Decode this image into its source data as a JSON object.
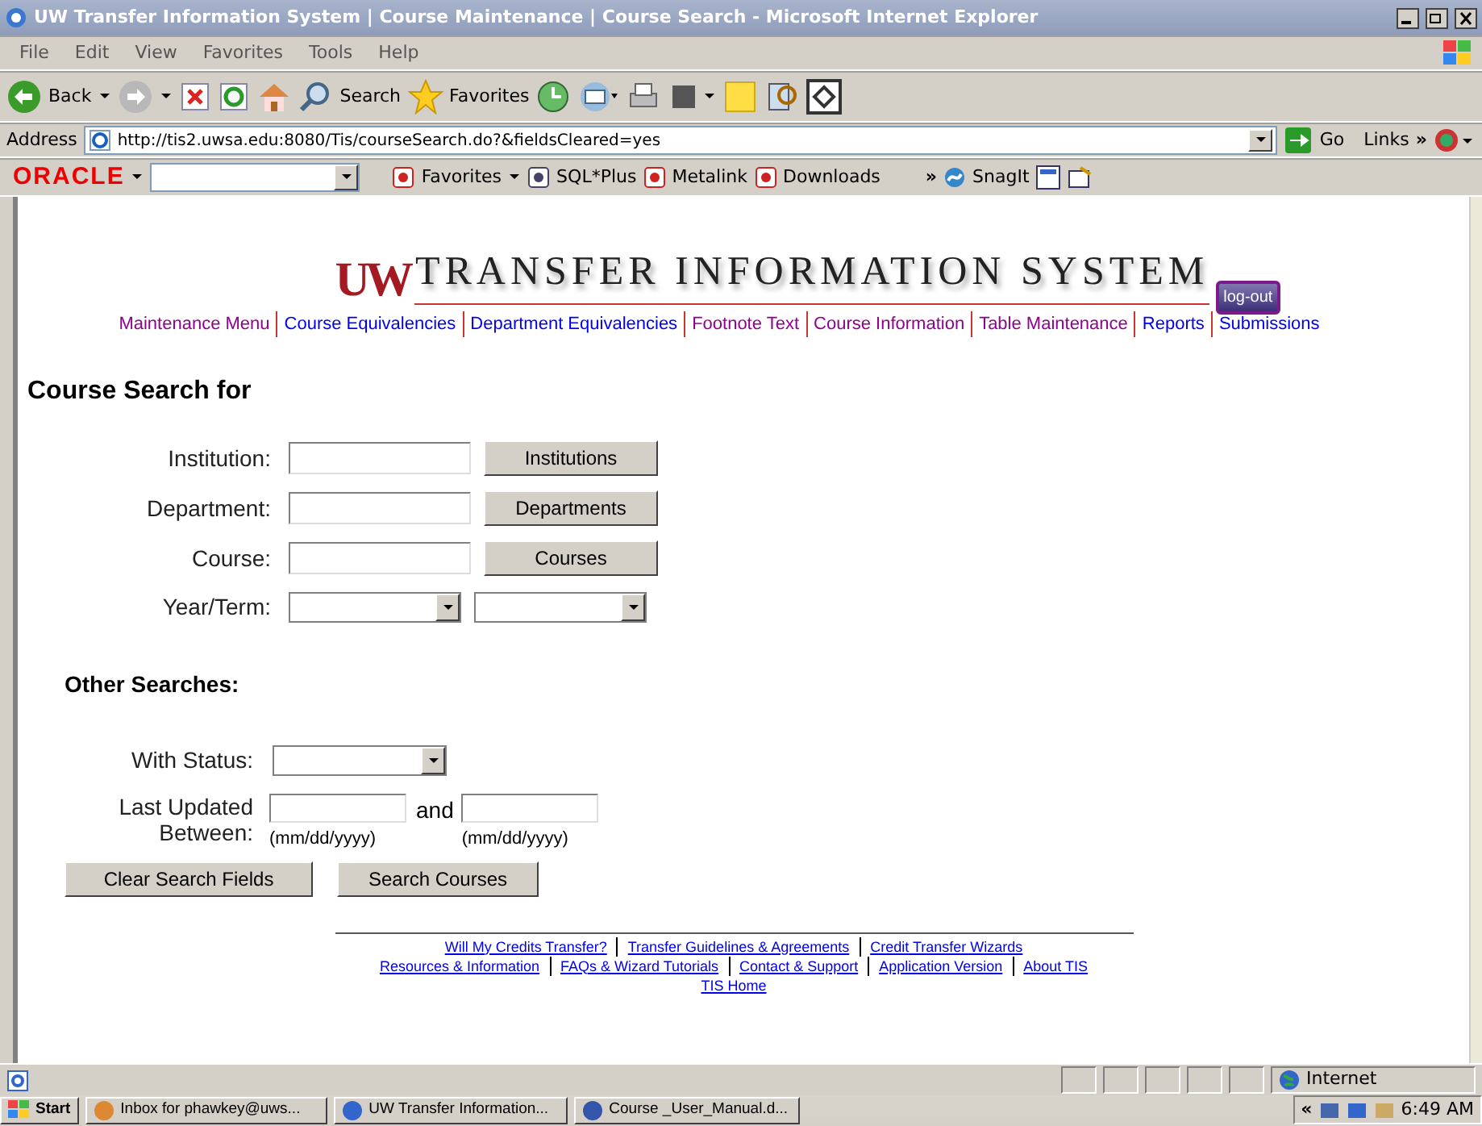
{
  "window": {
    "title": "UW Transfer Information System | Course Maintenance | Course Search - Microsoft Internet Explorer"
  },
  "menu": [
    "File",
    "Edit",
    "View",
    "Favorites",
    "Tools",
    "Help"
  ],
  "toolbar": {
    "back": "Back",
    "search": "Search",
    "favorites": "Favorites"
  },
  "address": {
    "label": "Address",
    "url": "http://tis2.uwsa.edu:8080/Tis/courseSearch.do?&fieldsCleared=yes",
    "go": "Go",
    "links": "Links",
    "more": "»"
  },
  "oracle_bar": {
    "logo": "ORACLE",
    "items": [
      "Favorites",
      "SQL*Plus",
      "Metalink",
      "Downloads"
    ],
    "more": "»",
    "snagit": "SnagIt"
  },
  "header": {
    "logo": "UW",
    "title": "TRANSFER INFORMATION SYSTEM",
    "logout": "log-out"
  },
  "nav": [
    {
      "label": "Maintenance Menu",
      "visited": true
    },
    {
      "label": "Course Equivalencies",
      "visited": false
    },
    {
      "label": "Department Equivalencies",
      "visited": false
    },
    {
      "label": "Footnote Text",
      "visited": true
    },
    {
      "label": "Course Information",
      "visited": true
    },
    {
      "label": "Table Maintenance",
      "visited": true
    },
    {
      "label": "Reports",
      "visited": false
    },
    {
      "label": "Submissions",
      "visited": false
    }
  ],
  "heading": "Course Search for",
  "fields": [
    {
      "label": "Institution:",
      "kind": "text",
      "button": "Institutions"
    },
    {
      "label": "Department:",
      "kind": "text",
      "button": "Departments"
    },
    {
      "label": "Course:",
      "kind": "text",
      "button": "Courses"
    },
    {
      "label": "Year/Term:",
      "kind": "selects"
    }
  ],
  "other_heading": "Other Searches:",
  "status_label": "With Status:",
  "updated": {
    "label1": "Last Updated",
    "label2": "Between:",
    "and": "and",
    "hint1": "(mm/dd/yyyy)",
    "hint2": "(mm/dd/yyyy)"
  },
  "buttons": [
    "Clear Search Fields",
    "Search Courses"
  ],
  "footer": [
    [
      "Will My Credits Transfer?",
      "Transfer Guidelines & Agreements",
      "Credit Transfer Wizards"
    ],
    [
      "Resources & Information",
      "FAQs & Wizard Tutorials",
      "Contact & Support",
      "Application Version",
      "About TIS"
    ],
    [
      "TIS Home"
    ]
  ],
  "status_bar": {
    "zone": "Internet"
  },
  "taskbar": {
    "start": "Start",
    "tasks": [
      "Inbox for phawkey@uws...",
      "UW Transfer Information...",
      "Course _User_Manual.d..."
    ],
    "chevron": "«",
    "clock": "6:49 AM"
  }
}
